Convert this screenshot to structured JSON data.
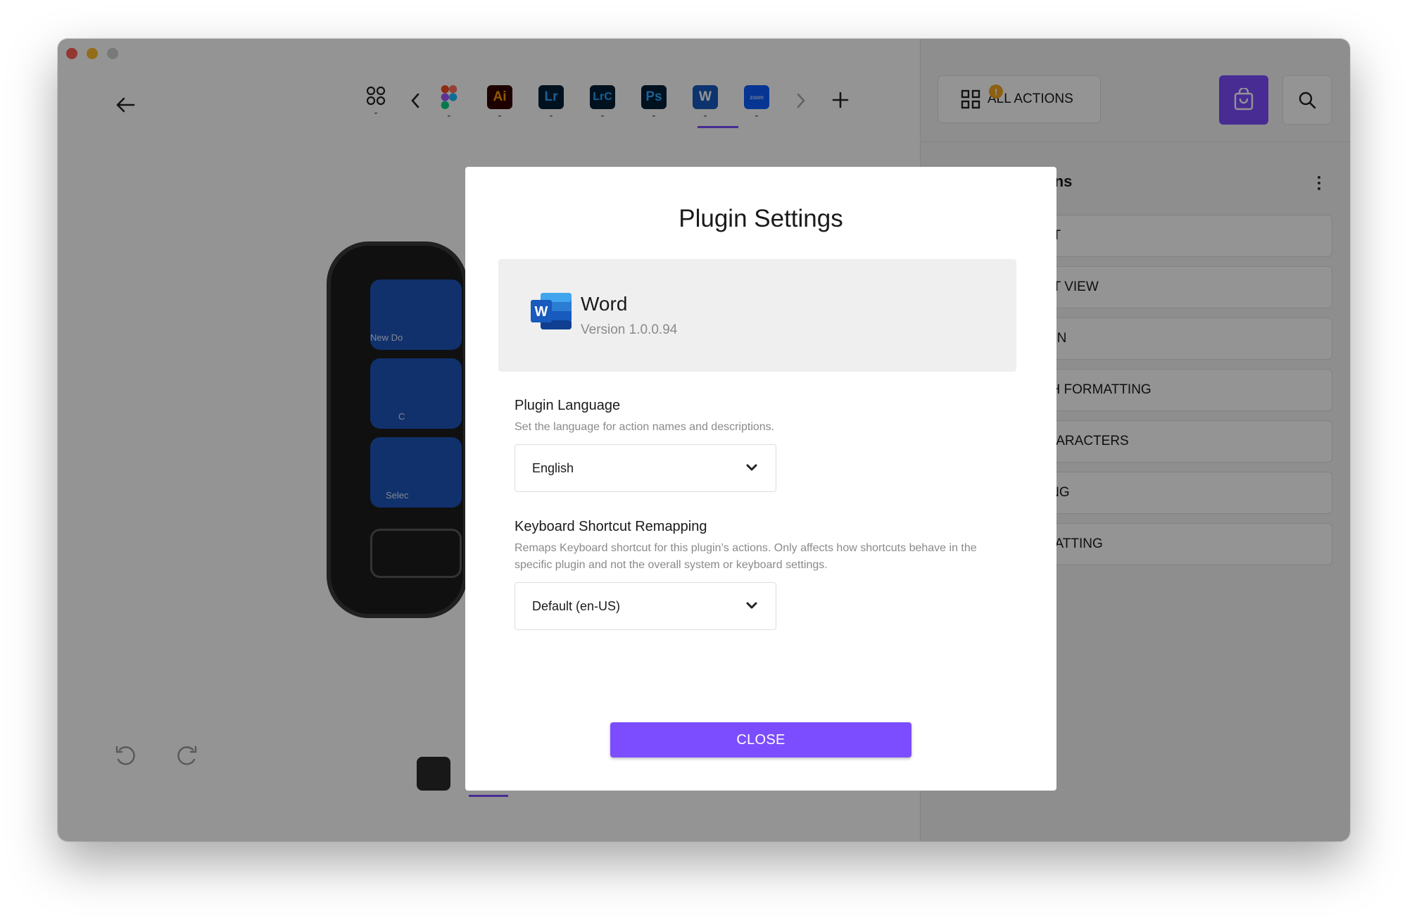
{
  "app": {
    "all_actions_label": "ALL ACTIONS",
    "all_actions_badge": "!",
    "section_title": "d Actions",
    "categories": [
      "CUMENT",
      "CUMENT VIEW",
      "VIGATION",
      "AGRAPH FORMATTING",
      "CIAL CHARACTERS",
      "T EDITING",
      "T FORMATTING"
    ],
    "app_strip": [
      {
        "label": "",
        "name": "figma"
      },
      {
        "label": "Ai",
        "name": "illustrator"
      },
      {
        "label": "Lr",
        "name": "lightroom"
      },
      {
        "label": "LrC",
        "name": "lightroom-classic"
      },
      {
        "label": "Ps",
        "name": "photoshop"
      },
      {
        "label": "W",
        "name": "word"
      },
      {
        "label": "zoom",
        "name": "zoom"
      }
    ],
    "device_keys": [
      "New Do",
      "C",
      "Selec"
    ],
    "accent_color": "#7c4dff"
  },
  "modal": {
    "title": "Plugin Settings",
    "plugin_name": "Word",
    "plugin_version": "Version 1.0.0.94",
    "language_label": "Plugin Language",
    "language_help": "Set the language for action names and descriptions.",
    "language_value": "English",
    "shortcut_label": "Keyboard Shortcut Remapping",
    "shortcut_help": "Remaps Keyboard shortcut for this plugin’s actions. Only affects how shortcuts behave in the specific plugin and not the overall system or keyboard settings.",
    "shortcut_value": "Default (en-US)",
    "close_label": "CLOSE"
  }
}
